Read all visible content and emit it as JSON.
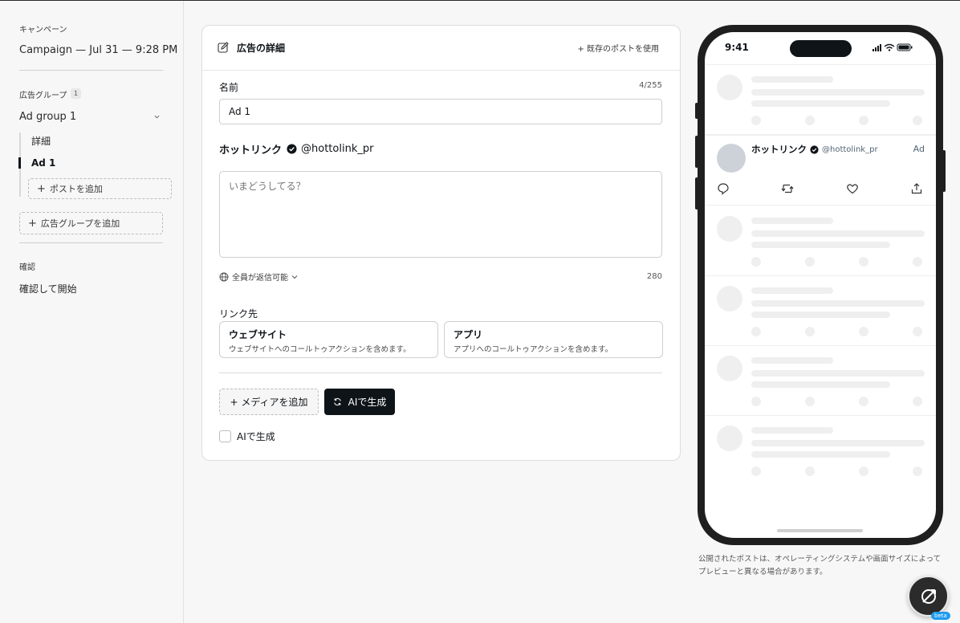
{
  "sidebar": {
    "campaign_label": "キャンペーン",
    "campaign_name": "Campaign — Jul 31 — 9:28 PM",
    "adgroup_label": "広告グループ",
    "adgroup_count": "1",
    "adgroup_name": "Ad group 1",
    "sub_items": [
      "詳細",
      "Ad 1"
    ],
    "add_post": "ポストを追加",
    "add_adgroup": "広告グループを追加",
    "confirm_label": "確認",
    "confirm_item": "確認して開始"
  },
  "card": {
    "title": "広告の詳細",
    "use_existing": "既存のポストを使用",
    "name_label": "名前",
    "name_count": "4/255",
    "name_value": "Ad 1",
    "account_name": "ホットリンク",
    "account_handle": "@hottolink_pr",
    "textarea_placeholder": "いまどうしてる？",
    "reply_setting": "全員が返信可能",
    "text_count": "280",
    "link_label": "リンク先",
    "link_options": [
      {
        "title": "ウェブサイト",
        "desc": "ウェブサイトへのコールトゥアクションを含めます。"
      },
      {
        "title": "アプリ",
        "desc": "アプリへのコールトゥアクションを含めます。"
      }
    ],
    "add_media": "+ メディアを追加",
    "ai_generate": "AIで生成",
    "ai_checkbox_label": "AIで生成"
  },
  "phone": {
    "time": "9:41",
    "tweet_name": "ホットリンク",
    "tweet_handle": "@hottolink_pr",
    "tweet_ad": "Ad"
  },
  "preview_note": "公開されたポストは、オペレーティングシステムや画面サイズによってプレビューと異なる場合があります。",
  "fab": {
    "beta": "beta"
  }
}
